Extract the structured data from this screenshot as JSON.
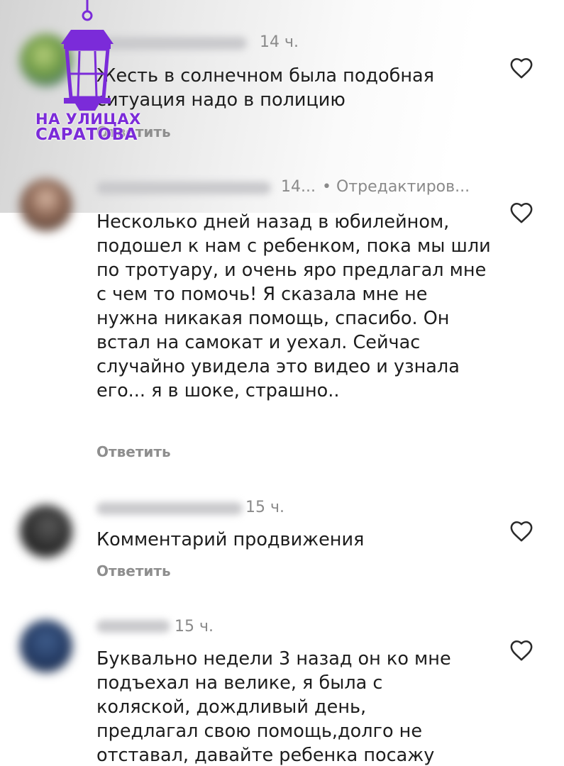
{
  "comments": [
    {
      "time": "14 ч.",
      "edited": "",
      "text": "Жесть в солнечном была подобная ситуация надо в полицию",
      "reply_label": "Ответить"
    },
    {
      "time": "14...",
      "edited": "• Отредактиров...",
      "text": "Несколько дней назад в юбилейном, подошел к нам с ребенком, пока мы шли по тротуару, и очень яро предлагал мне с чем то помочь! Я сказала мне не нужна никакая помощь, спасибо. Он встал на самокат и уехал. Сейчас случайно увидела это видео и узнала его... я в шоке, страшно..",
      "reply_label": "Ответить"
    },
    {
      "time": "15 ч.",
      "edited": "",
      "text": "Комментарий продвижения",
      "reply_label": "Ответить"
    },
    {
      "time": "15 ч.",
      "edited": "",
      "text": "Буквально недели 3 назад он ко мне подъехал на велике, я была с коляской, дождливый день, предлагал свою помощь,долго не отставал, давайте ребенка посажу",
      "reply_label": ""
    }
  ],
  "watermark": {
    "line1": "НА УЛИЦАХ",
    "line2": "САРАТОВА"
  },
  "colors": {
    "text": "#1d1d1d",
    "muted": "#8a8a8a",
    "watermark": "#7b2bd9"
  },
  "icons": {
    "like": "heart-outline-icon",
    "watermark": "lantern-icon"
  }
}
